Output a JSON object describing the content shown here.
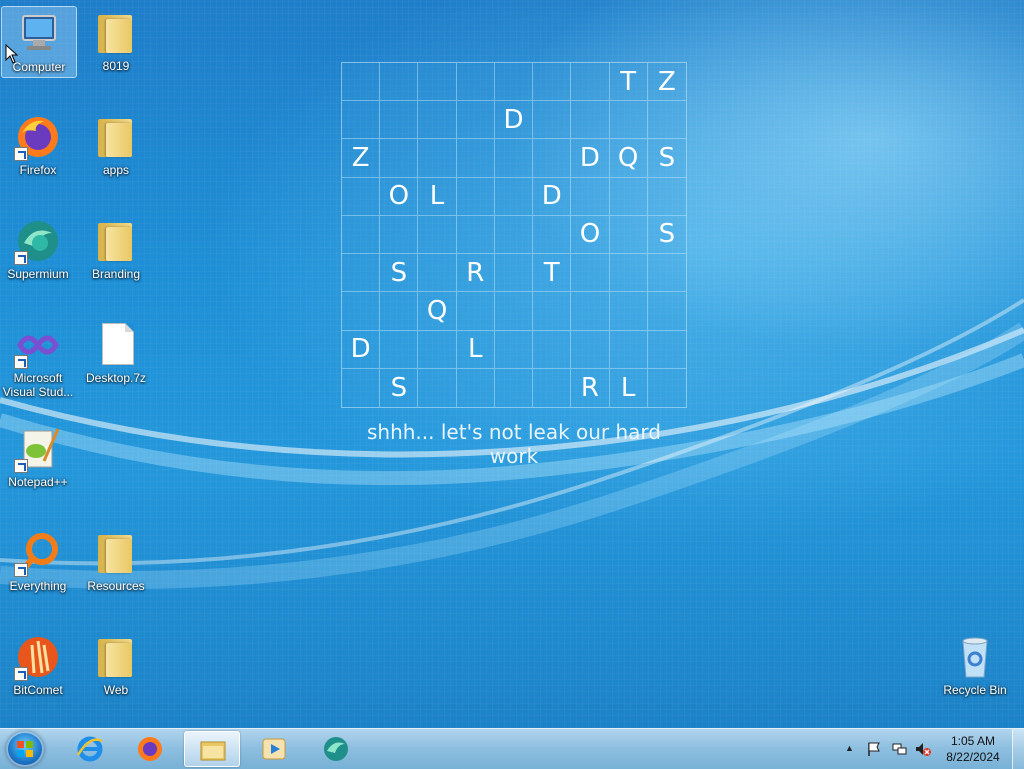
{
  "desktop": {
    "icons": [
      {
        "label": "Computer",
        "icon": "computer-icon"
      },
      {
        "label": "8019",
        "icon": "folder-icon"
      },
      {
        "label": "Firefox",
        "icon": "firefox-icon"
      },
      {
        "label": "apps",
        "icon": "folder-icon"
      },
      {
        "label": "Supermium",
        "icon": "supermium-icon"
      },
      {
        "label": "Branding",
        "icon": "folder-icon"
      },
      {
        "label": "Microsoft Visual Stud...",
        "icon": "visual-studio-icon"
      },
      {
        "label": "Desktop.7z",
        "icon": "file-icon"
      },
      {
        "label": "Notepad++",
        "icon": "notepad-plus-plus-icon"
      },
      {
        "label": "Everything",
        "icon": "everything-search-icon"
      },
      {
        "label": "Resources",
        "icon": "folder-icon"
      },
      {
        "label": "BitComet",
        "icon": "bitcomet-icon"
      },
      {
        "label": "Web",
        "icon": "folder-icon"
      },
      {
        "label": "Recycle Bin",
        "icon": "recycle-bin-icon"
      }
    ]
  },
  "wallpaper": {
    "grid": [
      [
        "",
        "",
        "",
        "",
        "",
        "",
        "",
        "T",
        "Z"
      ],
      [
        "",
        "",
        "",
        "",
        "D",
        "",
        "",
        "",
        ""
      ],
      [
        "Z",
        "",
        "",
        "",
        "",
        "",
        "D",
        "Q",
        "S"
      ],
      [
        "",
        "O",
        "L",
        "",
        "",
        "D",
        "",
        "",
        ""
      ],
      [
        "",
        "",
        "",
        "",
        "",
        "",
        "O",
        "",
        "S"
      ],
      [
        "",
        "S",
        "",
        "R",
        "",
        "T",
        "",
        "",
        ""
      ],
      [
        "",
        "",
        "Q",
        "",
        "",
        "",
        "",
        "",
        ""
      ],
      [
        "D",
        "",
        "",
        "L",
        "",
        "",
        "",
        "",
        ""
      ],
      [
        "",
        "S",
        "",
        "",
        "",
        "",
        "R",
        "L",
        ""
      ]
    ],
    "tagline": "shhh... let's not leak our hard work"
  },
  "taskbar": {
    "start_icon": "windows-start-icon",
    "pinned": [
      {
        "name": "internet-explorer-icon"
      },
      {
        "name": "firefox-icon"
      },
      {
        "name": "file-explorer-icon",
        "active": true
      },
      {
        "name": "media-player-icon"
      },
      {
        "name": "supermium-icon"
      }
    ],
    "tray": {
      "time": "1:05 AM",
      "date": "8/22/2024"
    }
  },
  "colors": {
    "desktop_blue": "#1e8fd6",
    "taskbar": "#a9cbe2",
    "grid_text": "#ffffff"
  }
}
